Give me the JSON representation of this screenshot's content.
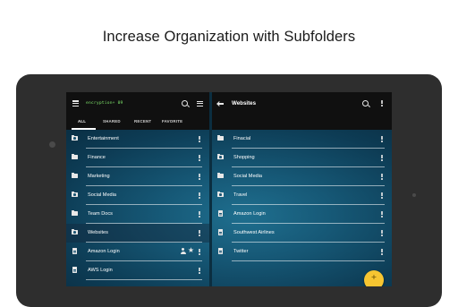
{
  "headline": "Increase Organization with Subfolders",
  "left_pane": {
    "logo": "encryption+ 09",
    "tabs": [
      "ALL",
      "SHARED",
      "RECENT",
      "FAVORITE"
    ],
    "active_tab": "ALL",
    "items": [
      {
        "label": "Entertainment",
        "icon": "shared-folder-icon"
      },
      {
        "label": "Finance",
        "icon": "folder-icon"
      },
      {
        "label": "Marketing",
        "icon": "folder-icon"
      },
      {
        "label": "Social Media",
        "icon": "shared-folder-icon"
      },
      {
        "label": "Team Docs",
        "icon": "folder-icon"
      },
      {
        "label": "Websites",
        "icon": "shared-folder-icon",
        "selected": true
      },
      {
        "label": "Amazon Login",
        "icon": "document-icon"
      },
      {
        "label": "AWS Login",
        "icon": "document-icon"
      }
    ]
  },
  "right_pane": {
    "title": "Websites",
    "items": [
      {
        "label": "Finacial",
        "icon": "folder-icon"
      },
      {
        "label": "Shopping",
        "icon": "shared-folder-icon"
      },
      {
        "label": "Social Media",
        "icon": "folder-icon"
      },
      {
        "label": "Travel",
        "icon": "shared-folder-icon"
      },
      {
        "label": "Amazon Login",
        "icon": "document-icon"
      },
      {
        "label": "Southwest Airlines",
        "icon": "document-icon"
      },
      {
        "label": "Twitter",
        "icon": "document-icon"
      }
    ]
  },
  "fab_label": "+",
  "colors": {
    "accent_fab": "#f7c531",
    "list_bg": "#165876",
    "appbar": "#101010",
    "logo": "#7ee36a"
  }
}
